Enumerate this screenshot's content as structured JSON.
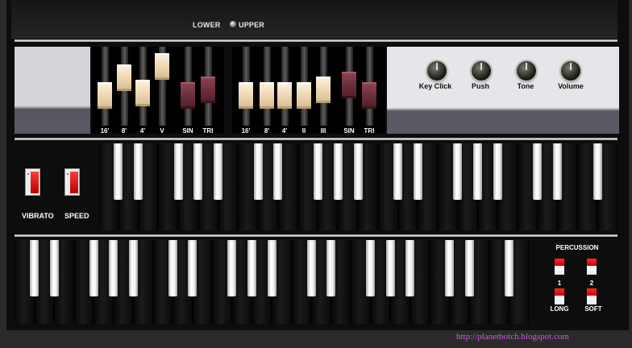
{
  "manual_selector": {
    "lower_label": "LOWER",
    "upper_label": "UPPER",
    "selected": "upper"
  },
  "drawbars": {
    "left": [
      {
        "label": "16'",
        "color": "ivory",
        "pull": 0.55
      },
      {
        "label": "8'",
        "color": "ivory",
        "pull": 0.22
      },
      {
        "label": "4'",
        "color": "ivory",
        "pull": 0.5
      },
      {
        "label": "V",
        "color": "ivory",
        "pull": 0.0
      },
      {
        "label": "SIN",
        "color": "maroon",
        "pull": 0.55
      },
      {
        "label": "TRI",
        "color": "maroon",
        "pull": 0.45
      }
    ],
    "right": [
      {
        "label": "16'",
        "color": "ivory",
        "pull": 0.55
      },
      {
        "label": "8'",
        "color": "ivory",
        "pull": 0.55
      },
      {
        "label": "4'",
        "color": "ivory",
        "pull": 0.55
      },
      {
        "label": "II",
        "color": "ivory",
        "pull": 0.55
      },
      {
        "label": "III",
        "color": "ivory",
        "pull": 0.45
      },
      {
        "label": "SIN",
        "color": "maroon",
        "pull": 0.36
      },
      {
        "label": "TRI",
        "color": "maroon",
        "pull": 0.55
      }
    ]
  },
  "controls": {
    "knobs": [
      {
        "label": "Key Click"
      },
      {
        "label": "Push"
      },
      {
        "label": "Tone"
      },
      {
        "label": "Volume"
      }
    ]
  },
  "vibrato": {
    "vibrato_label": "VIBRATO",
    "speed_label": "SPEED"
  },
  "percussion": {
    "title": "PERCUSSION",
    "label_1": "1",
    "label_2": "2",
    "long_label": "LONG",
    "soft_label": "SOFT"
  },
  "credit": "http://planetbotch.blogspot.com",
  "colors": {
    "ivory": "#ecd4ae",
    "maroon": "#6a2d3a",
    "switch_red": "#e00000",
    "credit": "#cf5bdc"
  }
}
